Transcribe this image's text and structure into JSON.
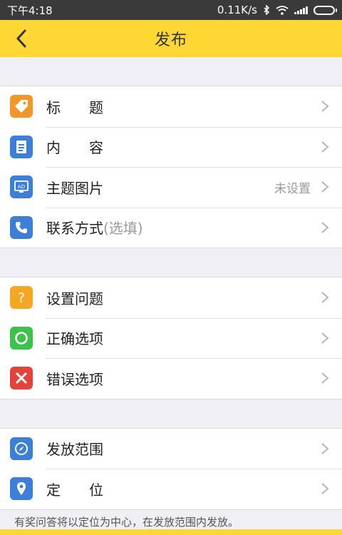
{
  "status_bar": {
    "time": "下午4:18",
    "speed": "0.11K/s"
  },
  "header": {
    "title": "发布"
  },
  "groups": [
    {
      "items": [
        {
          "label": "标　　题",
          "value": "",
          "icon": "tag-icon",
          "color": "#f0962a"
        },
        {
          "label": "内　　容",
          "value": "",
          "icon": "document-icon",
          "color": "#3d7fd6"
        },
        {
          "label": "主题图片",
          "value": "未设置",
          "icon": "ad-image-icon",
          "color": "#3d7fd6"
        },
        {
          "label": "联系方式",
          "hint": "(选填)",
          "value": "",
          "icon": "phone-icon",
          "color": "#3d7fd6"
        }
      ]
    },
    {
      "items": [
        {
          "label": "设置问题",
          "icon": "question-icon",
          "color": "#f5a623"
        },
        {
          "label": "正确选项",
          "icon": "circle-icon",
          "color": "#3cc24a"
        },
        {
          "label": "错误选项",
          "icon": "cross-icon",
          "color": "#e0443a"
        }
      ]
    },
    {
      "items": [
        {
          "label": "发放范围",
          "icon": "compass-icon",
          "color": "#3d7fd6"
        },
        {
          "label": "定　　位",
          "icon": "location-pin-icon",
          "color": "#3d7fd6"
        }
      ]
    }
  ],
  "note": "有奖问答将以定位为中心，在发放范围内发放。"
}
